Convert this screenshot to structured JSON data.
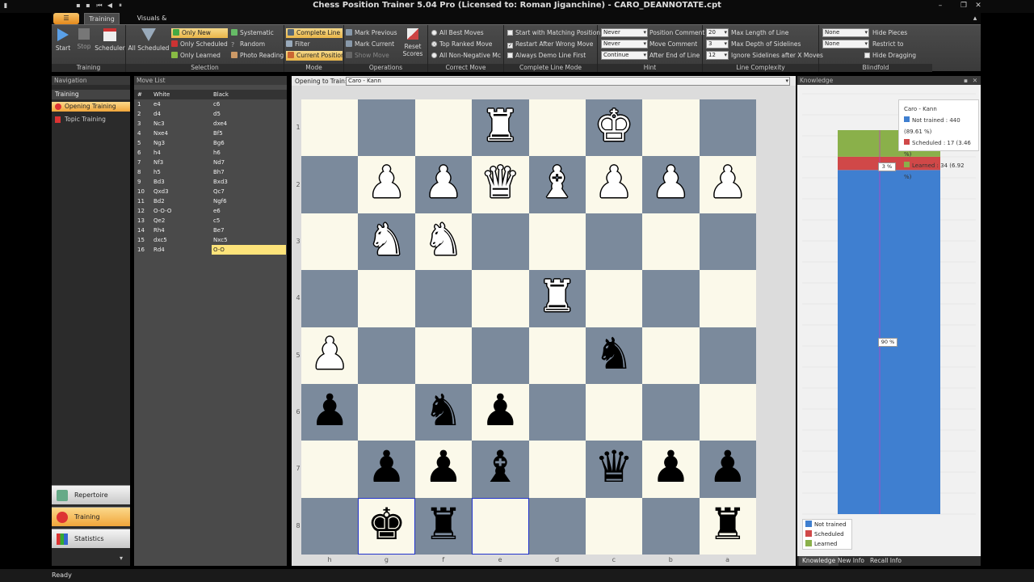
{
  "window": {
    "title": "Chess Position Trainer 5.04 Pro (Licensed to: Roman Jiganchine) - CARO_DEANNOTATE.cpt"
  },
  "ribbon": {
    "tabs": [
      "Training",
      "Visuals & Sound"
    ],
    "groups": {
      "training": {
        "label": "Training",
        "start": "Start",
        "stop": "Stop",
        "scheduler": "Scheduler"
      },
      "selection": {
        "label": "Selection",
        "all_scheduled": "All Scheduled",
        "only_new": "Only New",
        "only_scheduled": "Only Scheduled",
        "only_learned": "Only Learned",
        "systematic": "Systematic",
        "random": "Random",
        "photo_reading": "Photo Reading"
      },
      "mode": {
        "label": "Mode",
        "complete_line": "Complete Line",
        "filter": "Filter",
        "current_position": "Current Position"
      },
      "operations": {
        "label": "Operations",
        "mark_previous": "Mark Previous",
        "mark_current": "Mark Current",
        "show_move": "Show Move",
        "reset_scores_1": "Reset",
        "reset_scores_2": "Scores"
      },
      "correct_move": {
        "label": "Correct Move",
        "all_best": "All Best Moves",
        "top_ranked": "Top Ranked Move",
        "all_non_negative": "All Non-Negative Mc"
      },
      "complete_line_mode": {
        "label": "Complete Line Mode",
        "start_matching": "Start with Matching Position",
        "restart_wrong": "Restart After Wrong Move",
        "always_demo": "Always Demo Line First"
      },
      "hint": {
        "label": "Hint",
        "position_comment_value": "Never",
        "move_comment_value": "Never",
        "end_of_line_value": "Continue",
        "position_comment": "Position Comment",
        "move_comment": "Move Comment",
        "end_of_line": "After End of Line"
      },
      "line_complexity": {
        "label": "Line Complexity",
        "max_length_value": "20",
        "max_depth_value": "3",
        "ignore_after_value": "12",
        "max_length": "Max Length of Line",
        "max_depth": "Max Depth of Sidelines",
        "ignore_after": "Ignore Sidelines after X Moves"
      },
      "blindfold": {
        "label": "Blindfold",
        "hide_value_1": "None",
        "hide_value_2": "None",
        "hide_pieces": "Hide Pieces",
        "restrict_to": "Restrict to",
        "hide_dragging": "Hide Dragging"
      }
    }
  },
  "navigation": {
    "title": "Navigation",
    "section": "Training",
    "items": [
      "Opening Training",
      "Topic Training"
    ],
    "bottom": [
      "Repertoire",
      "Training",
      "Statistics"
    ]
  },
  "movelist": {
    "title": "Move List",
    "headers": [
      "#",
      "White",
      "Black"
    ],
    "rows": [
      [
        "1",
        "e4",
        "c6"
      ],
      [
        "2",
        "d4",
        "d5"
      ],
      [
        "3",
        "Nc3",
        "dxe4"
      ],
      [
        "4",
        "Nxe4",
        "Bf5"
      ],
      [
        "5",
        "Ng3",
        "Bg6"
      ],
      [
        "6",
        "h4",
        "h6"
      ],
      [
        "7",
        "Nf3",
        "Nd7"
      ],
      [
        "8",
        "h5",
        "Bh7"
      ],
      [
        "9",
        "Bd3",
        "Bxd3"
      ],
      [
        "10",
        "Qxd3",
        "Qc7"
      ],
      [
        "11",
        "Bd2",
        "Ngf6"
      ],
      [
        "12",
        "O-O-O",
        "e6"
      ],
      [
        "13",
        "Qe2",
        "c5"
      ],
      [
        "14",
        "Rh4",
        "Be7"
      ],
      [
        "15",
        "dxc5",
        "Nxc5"
      ],
      [
        "16",
        "Rd4",
        "O-O"
      ]
    ]
  },
  "opening": {
    "label": "Opening to Train:",
    "value": "Caro - Kann"
  },
  "board": {
    "ranks": [
      "1",
      "2",
      "3",
      "4",
      "5",
      "6",
      "7",
      "8"
    ],
    "files": [
      "h",
      "g",
      "f",
      "e",
      "d",
      "c",
      "b",
      "a"
    ],
    "pieces": [
      {
        "sq": "e1",
        "t": "rook",
        "c": "w"
      },
      {
        "sq": "c1",
        "t": "king",
        "c": "w"
      },
      {
        "sq": "g2",
        "t": "pawn",
        "c": "w"
      },
      {
        "sq": "f2",
        "t": "pawn",
        "c": "w"
      },
      {
        "sq": "e2",
        "t": "queen",
        "c": "w"
      },
      {
        "sq": "d2",
        "t": "bishop",
        "c": "w"
      },
      {
        "sq": "c2",
        "t": "pawn",
        "c": "w"
      },
      {
        "sq": "b2",
        "t": "pawn",
        "c": "w"
      },
      {
        "sq": "a2",
        "t": "pawn",
        "c": "w"
      },
      {
        "sq": "g3",
        "t": "knight",
        "c": "w"
      },
      {
        "sq": "f3",
        "t": "knight",
        "c": "w"
      },
      {
        "sq": "d4",
        "t": "rook",
        "c": "w"
      },
      {
        "sq": "h5",
        "t": "pawn",
        "c": "w"
      },
      {
        "sq": "c5",
        "t": "knight",
        "c": "b"
      },
      {
        "sq": "h6",
        "t": "pawn",
        "c": "b"
      },
      {
        "sq": "f6",
        "t": "knight",
        "c": "b"
      },
      {
        "sq": "e6",
        "t": "pawn",
        "c": "b"
      },
      {
        "sq": "g7",
        "t": "pawn",
        "c": "b"
      },
      {
        "sq": "f7",
        "t": "pawn",
        "c": "b"
      },
      {
        "sq": "e7",
        "t": "bishop",
        "c": "b"
      },
      {
        "sq": "c7",
        "t": "queen",
        "c": "b"
      },
      {
        "sq": "b7",
        "t": "pawn",
        "c": "b"
      },
      {
        "sq": "a7",
        "t": "pawn",
        "c": "b"
      },
      {
        "sq": "g8",
        "t": "king",
        "c": "b"
      },
      {
        "sq": "f8",
        "t": "rook",
        "c": "b"
      },
      {
        "sq": "a8",
        "t": "rook",
        "c": "b"
      }
    ],
    "highlighted": [
      "g8",
      "e8"
    ]
  },
  "knowledge": {
    "title": "Knowledge",
    "tooltip": {
      "title": "Caro - Kann",
      "not_trained": "Not trained : 440 (89.61 %)",
      "scheduled": "Scheduled : 17 (3.46 %)",
      "learned": "Learned : 34 (6.92 %)"
    },
    "bar_labels": {
      "scheduled": "3 %",
      "not_trained": "90 %"
    },
    "legend": [
      "Not trained",
      "Scheduled",
      "Learned"
    ],
    "tabs": [
      "Knowledge",
      "New Info",
      "Recall Info"
    ],
    "colors": {
      "not_trained": "#3f7fd0",
      "scheduled": "#d04848",
      "learned": "#8ab04a"
    }
  },
  "chart_data": {
    "type": "bar",
    "categories": [
      "Caro - Kann"
    ],
    "series": [
      {
        "name": "Not trained",
        "values": [
          440
        ]
      },
      {
        "name": "Scheduled",
        "values": [
          17
        ]
      },
      {
        "name": "Learned",
        "values": [
          34
        ]
      }
    ]
  },
  "status": {
    "text": "Ready"
  }
}
